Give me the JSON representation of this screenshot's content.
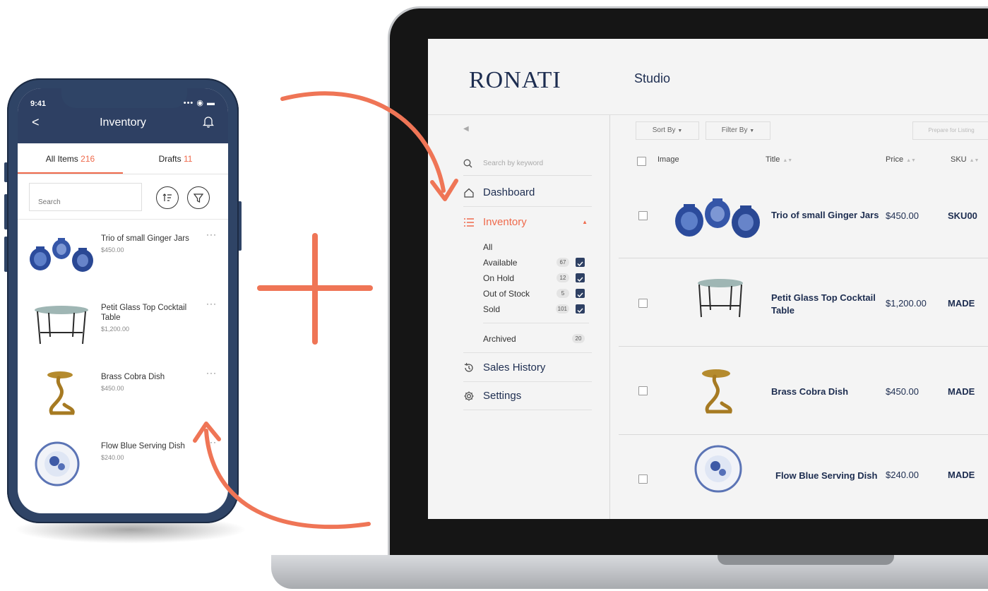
{
  "phone": {
    "time": "9:41",
    "status": "••• ◉ ▬",
    "title": "Inventory",
    "back": "<",
    "tabs": [
      {
        "label": "All Items",
        "count": "216"
      },
      {
        "label": "Drafts",
        "count": "11"
      }
    ],
    "search_placeholder": "Search",
    "items": [
      {
        "name": "Trio of small Ginger Jars",
        "price": "$450.00",
        "image": "ginger-jars"
      },
      {
        "name": "Petit Glass Top Cocktail Table",
        "price": "$1,200.00",
        "image": "glass-table"
      },
      {
        "name": "Brass Cobra Dish",
        "price": "$450.00",
        "image": "cobra-dish"
      },
      {
        "name": "Flow Blue Serving Dish",
        "price": "$240.00",
        "image": "blue-dish"
      }
    ],
    "dots": "···"
  },
  "desktop": {
    "logo": "RONATI",
    "section": "Studio",
    "search_placeholder": "Search by keyword",
    "nav": {
      "dashboard": "Dashboard",
      "inventory": "Inventory",
      "sales_history": "Sales History",
      "settings": "Settings"
    },
    "inventory_sub": [
      {
        "label": "All",
        "count": ""
      },
      {
        "label": "Available",
        "count": "67"
      },
      {
        "label": "On Hold",
        "count": "12"
      },
      {
        "label": "Out of Stock",
        "count": "5"
      },
      {
        "label": "Sold",
        "count": "101"
      }
    ],
    "archived": {
      "label": "Archived",
      "count": "20"
    },
    "toolbar": {
      "sort": "Sort By",
      "filter": "Filter By",
      "prepare": "Prepare for Listing"
    },
    "columns": {
      "image": "Image",
      "title": "Title",
      "price": "Price",
      "sku": "SKU"
    },
    "rows": [
      {
        "title": "Trio of small Ginger Jars",
        "price": "$450.00",
        "sku": "SKU00",
        "image": "ginger-jars"
      },
      {
        "title": "Petit Glass Top Cocktail Table",
        "price": "$1,200.00",
        "sku": "MADE",
        "image": "glass-table"
      },
      {
        "title": "Brass Cobra Dish",
        "price": "$450.00",
        "sku": "MADE",
        "image": "cobra-dish"
      },
      {
        "title": "Flow Blue Serving Dish",
        "price": "$240.00",
        "sku": "MADE",
        "image": "blue-dish"
      }
    ]
  },
  "colors": {
    "accent": "#ef6a4c",
    "navy": "#2e4063",
    "connector": "#ef7556"
  }
}
